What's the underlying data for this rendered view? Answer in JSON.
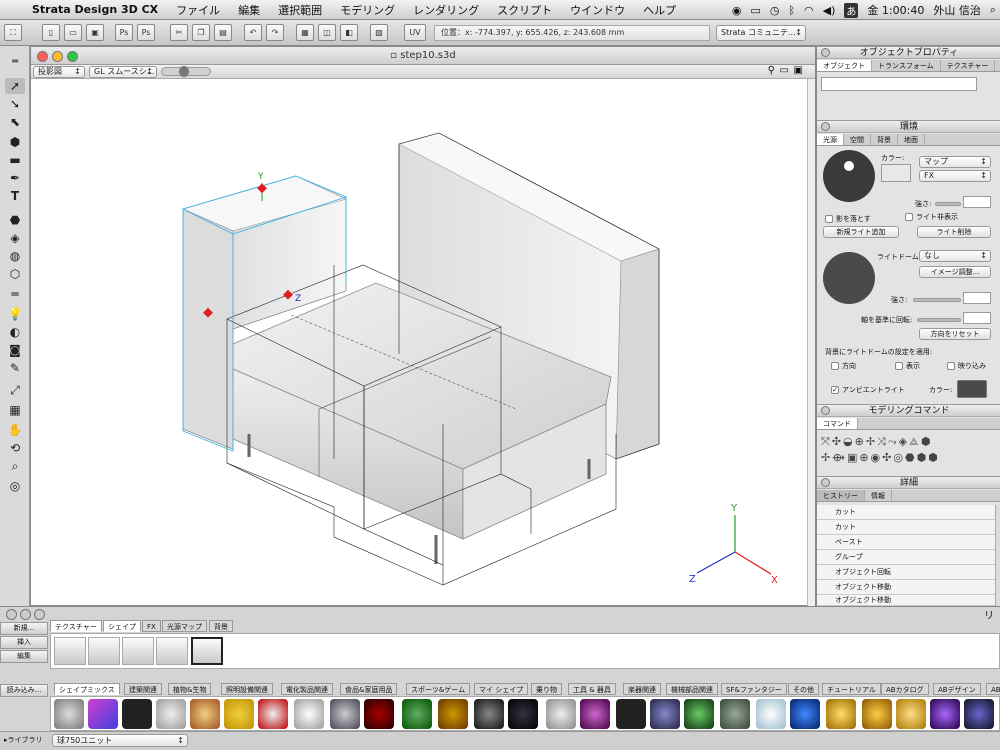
{
  "menubar": {
    "app": "Strata Design 3D CX",
    "items": [
      "ファイル",
      "編集",
      "選択範囲",
      "モデリング",
      "レンダリング",
      "スクリプト",
      "ウインドウ",
      "ヘルプ"
    ],
    "clock": "金 1:00:40",
    "user": "外山 信治",
    "input_mode": "あ"
  },
  "toolbar": {
    "coords": "位置：x: -774.397, y: 655.426, z: 243.608 mm",
    "community": "Strata コミュニテ..."
  },
  "document": {
    "title": "step10.s3d",
    "projection": "投影図",
    "render_mode": "GL スムースシ..."
  },
  "axis": {
    "x": "X",
    "y": "Y",
    "z": "Z"
  },
  "gizmo": {
    "y": "Y",
    "z": "Z"
  },
  "object_properties": {
    "title": "オブジェクトプロパティ",
    "tabs": [
      "オブジェクト",
      "トランスフォーム",
      "テクスチャー"
    ]
  },
  "environment": {
    "title": "環境",
    "tabs": [
      "光源",
      "空間",
      "背景",
      "地面"
    ],
    "color_label": "カラー:",
    "map_option": "マップ",
    "fx_option": "FX",
    "strength_label": "強さ:",
    "cast_shadow": "影を落とす",
    "hide_light": "ライト非表示",
    "add_light": "新規ライト追加",
    "delete_light": "ライト削除",
    "light_dome_label": "ライトドーム:",
    "light_dome_value": "なし",
    "image_adjust": "イメージ調整...",
    "strength2_label": "強さ:",
    "rotate_label": "軸を基準に回転:",
    "reset_direction": "方向をリセット",
    "apply_bg_label": "背景にライトドームの設定を適用:",
    "apply_direction": "方向",
    "apply_display": "表示",
    "apply_reflection": "映り込み",
    "ambient_light": "アンビエントライト",
    "ambient_color_label": "カラー:"
  },
  "modeling": {
    "title": "モデリングコマンド",
    "tab": "コマンド"
  },
  "detail": {
    "title": "詳細",
    "tabs": [
      "ヒストリー",
      "情報"
    ],
    "history": [
      "カット",
      "カット",
      "ペースト",
      "グループ",
      "オブジェクト回転",
      "オブジェクト移動",
      "オブジェクト移動"
    ]
  },
  "bottom": {
    "side_buttons": [
      "新規...",
      "挿入",
      "編集"
    ],
    "load_button": "読み込み...",
    "tabs": [
      "テクスチャー",
      "シェイプ",
      "FX",
      "光源マップ",
      "背景"
    ],
    "library_tabs": [
      "シェイプミックス",
      "建築関連",
      "植物&生物",
      "照明設備関連",
      "電化製品関連",
      "食品&家庭用品",
      "スポーツ&ゲーム",
      "マイ シェイプ",
      "乗り物",
      "工具 & 器具",
      "楽器関連",
      "機械部品関連",
      "SF&ファンタジー",
      "その他",
      "チュートリアル",
      "ABカタログ",
      "ABデザイン",
      "AB"
    ],
    "library_label": "▸ライブラリ",
    "library_select": "球750ユニット",
    "right_cut": "リ"
  },
  "colors": {
    "selection": "#3ab4e6",
    "axis_x": "#e02020",
    "axis_y": "#20a020",
    "axis_z": "#2030c0"
  }
}
